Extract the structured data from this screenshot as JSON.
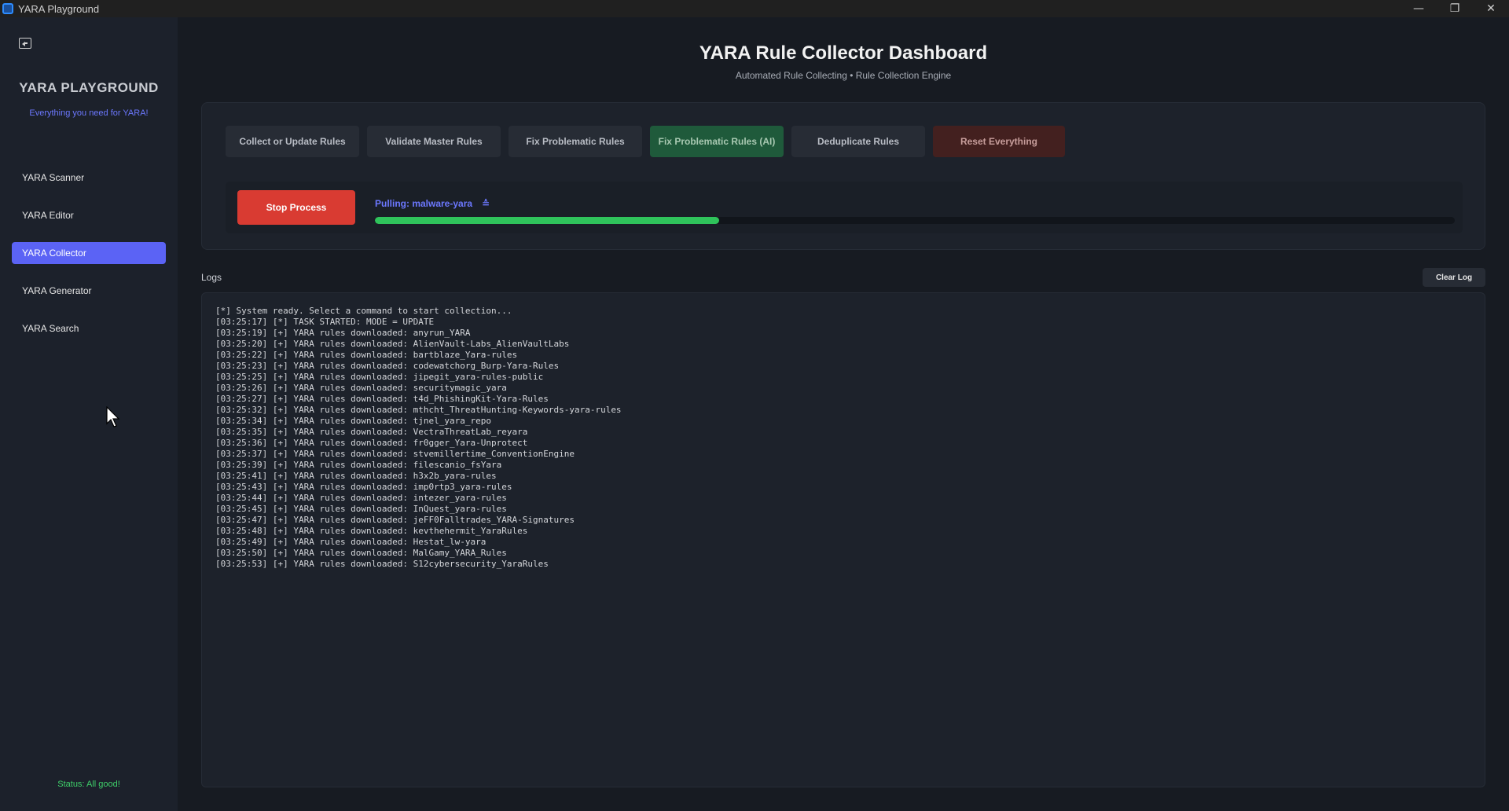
{
  "window": {
    "title": "YARA Playground",
    "controls": [
      "minimize",
      "restore",
      "close"
    ]
  },
  "sidebar": {
    "brand": "YARA PLAYGROUND",
    "tagline": "Everything you need for YARA!",
    "items": [
      {
        "label": "YARA Scanner",
        "active": false
      },
      {
        "label": "YARA Editor",
        "active": false
      },
      {
        "label": "YARA Collector",
        "active": true
      },
      {
        "label": "YARA Generator",
        "active": false
      },
      {
        "label": "YARA Search",
        "active": false
      }
    ],
    "status": "Status: All good!"
  },
  "main": {
    "title": "YARA Rule Collector Dashboard",
    "subtitle": "Automated Rule Collecting • Rule Collection Engine",
    "commands": [
      "Collect or Update Rules",
      "Validate Master Rules",
      "Fix Problematic Rules",
      "Fix Problematic Rules (AI)",
      "Deduplicate Rules",
      "Reset Everything"
    ],
    "stop_label": "Stop Process",
    "pull_status": "Pulling: malware-yara",
    "progress": 0.319,
    "logs_label": "Logs",
    "clear_label": "Clear Log",
    "log_lines": [
      "[*] System ready. Select a command to start collection...",
      "[03:25:17] [*] TASK STARTED: MODE = UPDATE",
      "[03:25:19] [+] YARA rules downloaded: anyrun_YARA",
      "[03:25:20] [+] YARA rules downloaded: AlienVault-Labs_AlienVaultLabs",
      "[03:25:22] [+] YARA rules downloaded: bartblaze_Yara-rules",
      "[03:25:23] [+] YARA rules downloaded: codewatchorg_Burp-Yara-Rules",
      "[03:25:25] [+] YARA rules downloaded: jipegit_yara-rules-public",
      "[03:25:26] [+] YARA rules downloaded: securitymagic_yara",
      "[03:25:27] [+] YARA rules downloaded: t4d_PhishingKit-Yara-Rules",
      "[03:25:32] [+] YARA rules downloaded: mthcht_ThreatHunting-Keywords-yara-rules",
      "[03:25:34] [+] YARA rules downloaded: tjnel_yara_repo",
      "[03:25:35] [+] YARA rules downloaded: VectraThreatLab_reyara",
      "[03:25:36] [+] YARA rules downloaded: fr0gger_Yara-Unprotect",
      "[03:25:37] [+] YARA rules downloaded: stvemillertime_ConventionEngine",
      "[03:25:39] [+] YARA rules downloaded: filescanio_fsYara",
      "[03:25:41] [+] YARA rules downloaded: h3x2b_yara-rules",
      "[03:25:43] [+] YARA rules downloaded: imp0rtp3_yara-rules",
      "[03:25:44] [+] YARA rules downloaded: intezer_yara-rules",
      "[03:25:45] [+] YARA rules downloaded: InQuest_yara-rules",
      "[03:25:47] [+] YARA rules downloaded: jeFF0Falltrades_YARA-Signatures",
      "[03:25:48] [+] YARA rules downloaded: kevthehermit_YaraRules",
      "[03:25:49] [+] YARA rules downloaded: Hestat_lw-yara",
      "[03:25:50] [+] YARA rules downloaded: MalGamy_YARA_Rules",
      "[03:25:53] [+] YARA rules downloaded: S12cybersecurity_YaraRules"
    ]
  }
}
